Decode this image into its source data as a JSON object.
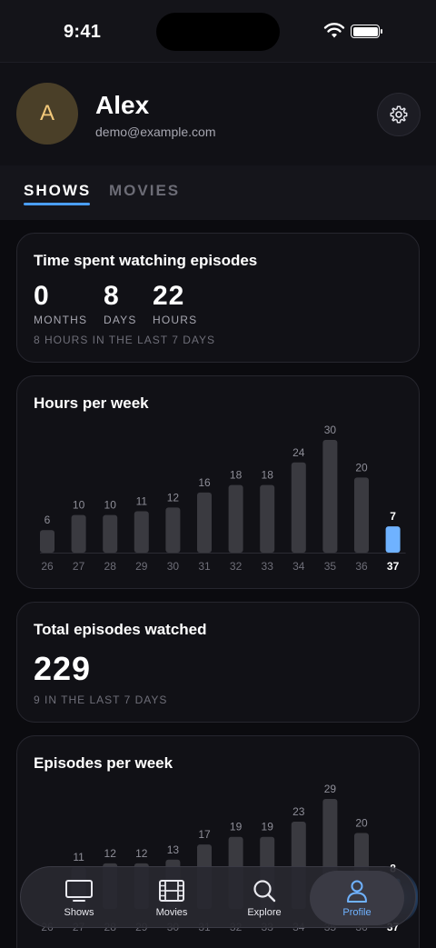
{
  "status_bar": {
    "time": "9:41"
  },
  "profile": {
    "initial": "A",
    "name": "Alex",
    "email": "demo@example.com"
  },
  "tabs": [
    {
      "label": "SHOWS",
      "active": true
    },
    {
      "label": "MOVIES",
      "active": false
    }
  ],
  "time_card": {
    "title": "Time spent watching episodes",
    "stats": [
      {
        "value": "0",
        "unit": "MONTHS"
      },
      {
        "value": "8",
        "unit": "DAYS"
      },
      {
        "value": "22",
        "unit": "HOURS"
      }
    ],
    "note": "8 HOURS IN THE LAST 7 DAYS"
  },
  "hours_card": {
    "title": "Hours per week"
  },
  "episodes_total_card": {
    "title": "Total episodes watched",
    "value": "229",
    "note": "9 IN THE LAST 7 DAYS"
  },
  "episodes_week_card": {
    "title": "Episodes per week"
  },
  "chart_data": [
    {
      "type": "bar",
      "title": "Hours per week",
      "categories": [
        "26",
        "27",
        "28",
        "29",
        "30",
        "31",
        "32",
        "33",
        "34",
        "35",
        "36",
        "37"
      ],
      "values": [
        6,
        10,
        10,
        11,
        12,
        16,
        18,
        18,
        24,
        30,
        20,
        7
      ],
      "highlight_index": 11,
      "ylim": [
        0,
        30
      ],
      "colors": {
        "bar": "#3a3a40",
        "highlight": "#6fb2ff"
      }
    },
    {
      "type": "bar",
      "title": "Episodes per week",
      "categories": [
        "26",
        "27",
        "28",
        "29",
        "30",
        "31",
        "32",
        "33",
        "34",
        "35",
        "36",
        "37"
      ],
      "values": [
        null,
        11,
        12,
        12,
        13,
        17,
        19,
        19,
        23,
        29,
        20,
        8
      ],
      "highlight_index": 11,
      "ylim": [
        0,
        29
      ],
      "colors": {
        "bar": "#3a3a40",
        "highlight": "#6fb2ff"
      }
    }
  ],
  "bottom_nav": [
    {
      "label": "Shows",
      "icon": "tv-icon",
      "active": false
    },
    {
      "label": "Movies",
      "icon": "film-icon",
      "active": false
    },
    {
      "label": "Explore",
      "icon": "search-icon",
      "active": false
    },
    {
      "label": "Profile",
      "icon": "person-icon",
      "active": true
    }
  ],
  "colors": {
    "accent": "#4a9eff",
    "background": "#0b0b0f",
    "card": "#111116"
  }
}
